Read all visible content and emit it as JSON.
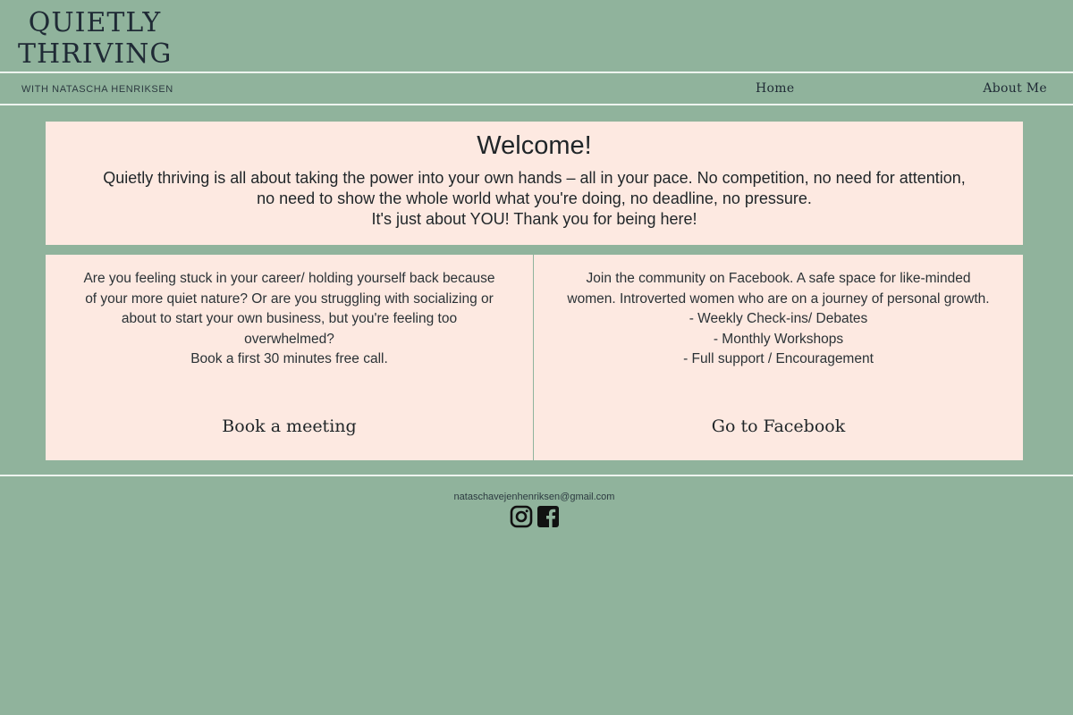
{
  "header": {
    "logo_line1": "QUIETLY",
    "logo_line2": "THRIVING",
    "tagline": "WITH NATASCHA HENRIKSEN",
    "nav": {
      "home": "Home",
      "about": "About Me"
    }
  },
  "welcome": {
    "title": "Welcome!",
    "line1": "Quietly thriving is all about taking the power into your own hands – all in your pace. No competition, no need for attention,",
    "line2": "no need to show the whole world what you're doing, no deadline, no pressure.",
    "line3": "It's just about YOU! Thank you for being here!"
  },
  "cards": {
    "left": {
      "lines": [
        "Are you feeling stuck in your career/ holding yourself back because",
        "of your more quiet nature? Or are you struggling with socializing or",
        "about to start your own business, but you're feeling too",
        "overwhelmed?",
        "Book a first 30 minutes free call."
      ],
      "button": "Book a meeting"
    },
    "right": {
      "lines": [
        "Join the community on Facebook. A safe space for like-minded",
        "women. Introverted women who are on a journey of personal growth.",
        "- Weekly Check-ins/ Debates",
        "- Monthly Workshops",
        "- Full support / Encouragement"
      ],
      "button": "Go to Facebook"
    }
  },
  "footer": {
    "email": "nataschavejenhenriksen@gmail.com",
    "icons": [
      "instagram-icon",
      "facebook-icon"
    ]
  },
  "colors": {
    "background": "#90b39c",
    "card": "#fde9e1",
    "rule": "#eef4ef",
    "text": "#1f2528"
  }
}
